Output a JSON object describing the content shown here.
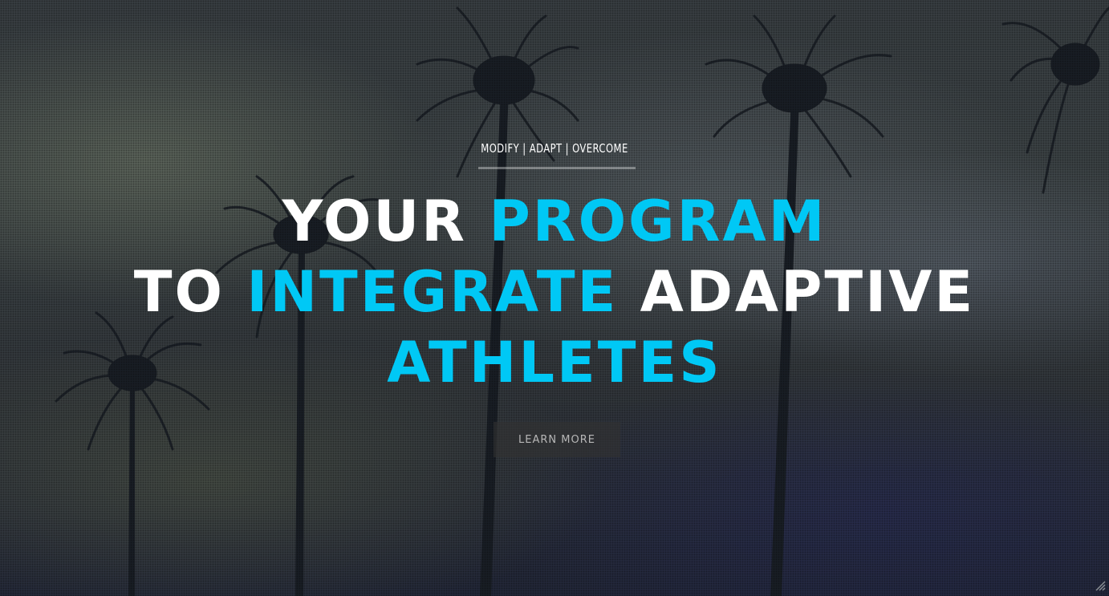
{
  "hero": {
    "tagline": "MODIFY | ADAPT | OVERCOME",
    "headline": {
      "line1_a": "YOUR ",
      "line1_b": "PROGRAM",
      "line2_a": "TO ",
      "line2_b": "INTEGRATE",
      "line2_c": " ADAPTIVE",
      "line3": "ATHLETES"
    },
    "cta_label": "LEARN MORE"
  },
  "colors": {
    "accent": "#00c8f5",
    "text": "#ffffff",
    "button_bg": "#333333",
    "button_text": "#b7b7b7"
  },
  "icons": {
    "corner": "resize-grip-icon"
  }
}
